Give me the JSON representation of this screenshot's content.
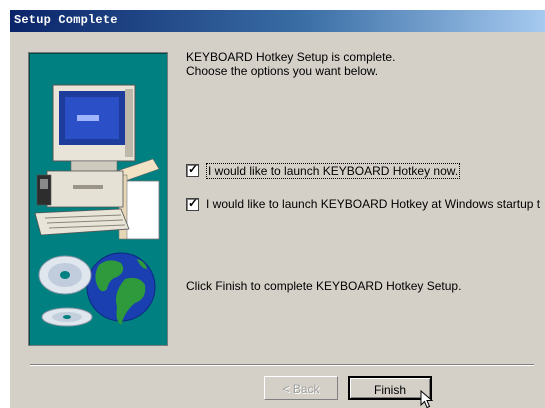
{
  "window": {
    "title": "Setup Complete"
  },
  "content": {
    "intro_line1": "KEYBOARD Hotkey Setup is complete.",
    "intro_line2": "Choose the options you want below.",
    "option_launch_now": {
      "label": "I would like to launch KEYBOARD Hotkey now.",
      "checked": true
    },
    "option_launch_startup": {
      "label": "I would like to launch KEYBOARD Hotkey at Windows startup t",
      "checked": true
    },
    "finish_instruction": "Click Finish to complete KEYBOARD Hotkey Setup."
  },
  "buttons": {
    "back_label": "< Back",
    "finish_label": "Finish"
  },
  "colors": {
    "dialog_bg": "#d4d0c8",
    "side_panel": "#008080",
    "title_gradient_start": "#0a246a",
    "title_gradient_end": "#a6caf0"
  },
  "icons": {
    "side_illustration": "computer-and-globe-illustration",
    "mouse_cursor": "arrow-cursor-icon"
  }
}
